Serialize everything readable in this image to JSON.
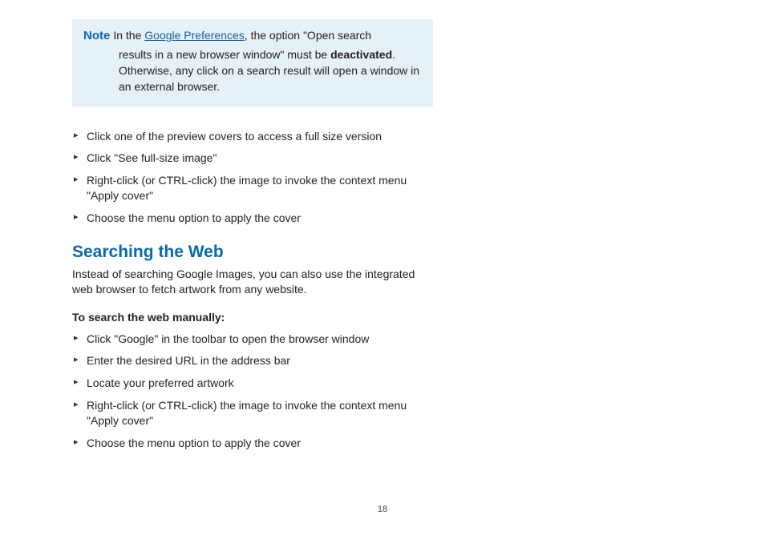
{
  "note": {
    "label": "Note",
    "pre_link": "In the ",
    "link_text": "Google Preferences",
    "post_link": ", the option \"Open search",
    "line2_pre": "results in a new browser window\" must be ",
    "bold": "deactivated",
    "line2_post": ". Otherwise, any click on a search result will open a window in an external browser."
  },
  "steps1": [
    "Click one of the preview covers to access a full size version",
    "Click \"See full-size image\"",
    "Right-click (or CTRL-click) the  image to invoke the context menu \"Apply cover\"",
    "Choose the menu option to apply the cover"
  ],
  "section": {
    "heading": "Searching the Web",
    "intro": "Instead of searching Google Images, you can also use the integrated web browser to fetch artwork from any website.",
    "subheading": "To search the web manually:"
  },
  "steps2": [
    "Click \"Google\" in the toolbar to open the browser window",
    "Enter the desired URL in the address bar",
    "Locate your preferred artwork",
    "Right-click (or CTRL-click) the  image to invoke the context menu \"Apply cover\"",
    "Choose the menu option to apply the cover"
  ],
  "page_number": "18"
}
